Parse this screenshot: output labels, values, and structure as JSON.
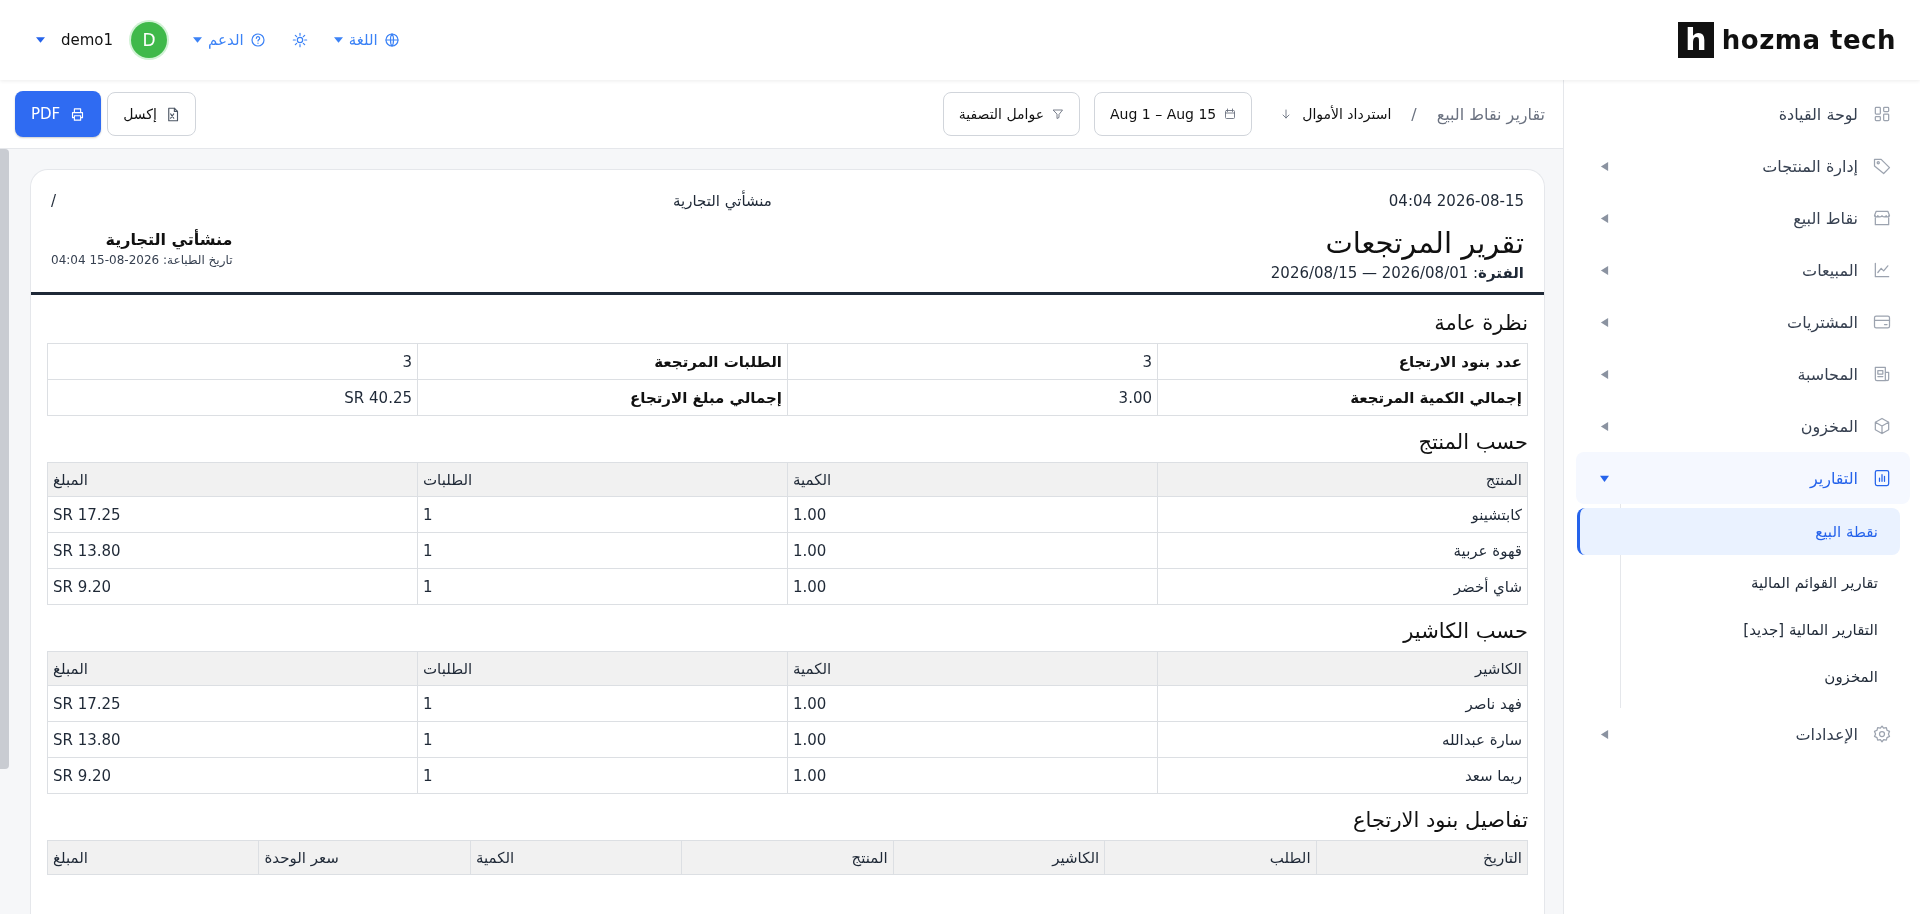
{
  "topbar": {
    "logo": {
      "mark": "h",
      "name": "hozma tech"
    },
    "language": "اللغة",
    "support": "الدعم",
    "avatar": "D",
    "user": "demo1"
  },
  "sidebar": {
    "items": [
      {
        "label": "لوحة القيادة",
        "expandable": false,
        "selected": false
      },
      {
        "label": "إدارة المنتجات",
        "expandable": true,
        "expanded": false,
        "selected": false
      },
      {
        "label": "نقاط البيع",
        "expandable": true,
        "expanded": false,
        "selected": false
      },
      {
        "label": "المبيعات",
        "expandable": true,
        "expanded": false,
        "selected": false
      },
      {
        "label": "المشتريات",
        "expandable": true,
        "expanded": false,
        "selected": false
      },
      {
        "label": "المحاسبة",
        "expandable": true,
        "expanded": false,
        "selected": false
      },
      {
        "label": "المخزون",
        "expandable": true,
        "expanded": false,
        "selected": false
      },
      {
        "label": "التقارير",
        "expandable": true,
        "expanded": true,
        "selected": true,
        "children": [
          {
            "label": "نقطة البيع",
            "selected": true
          },
          {
            "label": "تقارير القوائم المالية",
            "selected": false
          },
          {
            "label": "التقارير المالية [جديد]",
            "selected": false
          },
          {
            "label": "المخزون",
            "selected": false
          }
        ]
      },
      {
        "label": "الإعدادات",
        "expandable": true,
        "expanded": false,
        "selected": false
      }
    ]
  },
  "toolbar": {
    "breadcrumb": {
      "parent": "تقارير نقاط البيع",
      "separator": "/",
      "current": "استرداد الأموال"
    },
    "date_range": "Aug 1 – Aug 15",
    "filters": "عوامل التصفية",
    "excel": "إكسل",
    "pdf": "PDF"
  },
  "report": {
    "header": {
      "datetime": "2026-08-15 04:04",
      "company": "منشأتي التجارية",
      "page": "/"
    },
    "title": "تقرير المرتجعات",
    "period": "**الفترة**: 2026/08/01 — 2026/08/15",
    "company_name": "منشأتي التجارية",
    "print_date": "تاريخ الطباعة: 2026-08-15 04:04",
    "sections": [
      {
        "kind": "summary",
        "title": "نظرة عامة",
        "rows": [
          [
            "عدد بنود الارتجاع",
            "3",
            "الطلبات المرتجعة",
            "3"
          ],
          [
            "إجمالي الكمية المرتجعة",
            "3.00",
            "إجمالي مبلغ الارتجاع",
            "SR 40.25"
          ]
        ]
      },
      {
        "kind": "table",
        "title": "حسب المنتج",
        "columns": [
          "المنتج",
          "الكمية",
          "الطلبات",
          "المبلغ"
        ],
        "rows": [
          [
            "كابتشينو",
            "1.00",
            "1",
            "SR 17.25"
          ],
          [
            "قهوة عربية",
            "1.00",
            "1",
            "SR 13.80"
          ],
          [
            "شاي أخضر",
            "1.00",
            "1",
            "SR 9.20"
          ]
        ]
      },
      {
        "kind": "table",
        "title": "حسب الكاشير",
        "columns": [
          "الكاشير",
          "الكمية",
          "الطلبات",
          "المبلغ"
        ],
        "rows": [
          [
            "فهد ناصر",
            "1.00",
            "1",
            "SR 17.25"
          ],
          [
            "سارة عبدالله",
            "1.00",
            "1",
            "SR 13.80"
          ],
          [
            "ريما سعد",
            "1.00",
            "1",
            "SR 9.20"
          ]
        ]
      },
      {
        "kind": "table",
        "title": "تفاصيل بنود الارتجاع",
        "columns": [
          "التاريخ",
          "الطلب",
          "الكاشير",
          "المنتج",
          "الكمية",
          "سعر الوحدة",
          "المبلغ"
        ]
      }
    ]
  }
}
